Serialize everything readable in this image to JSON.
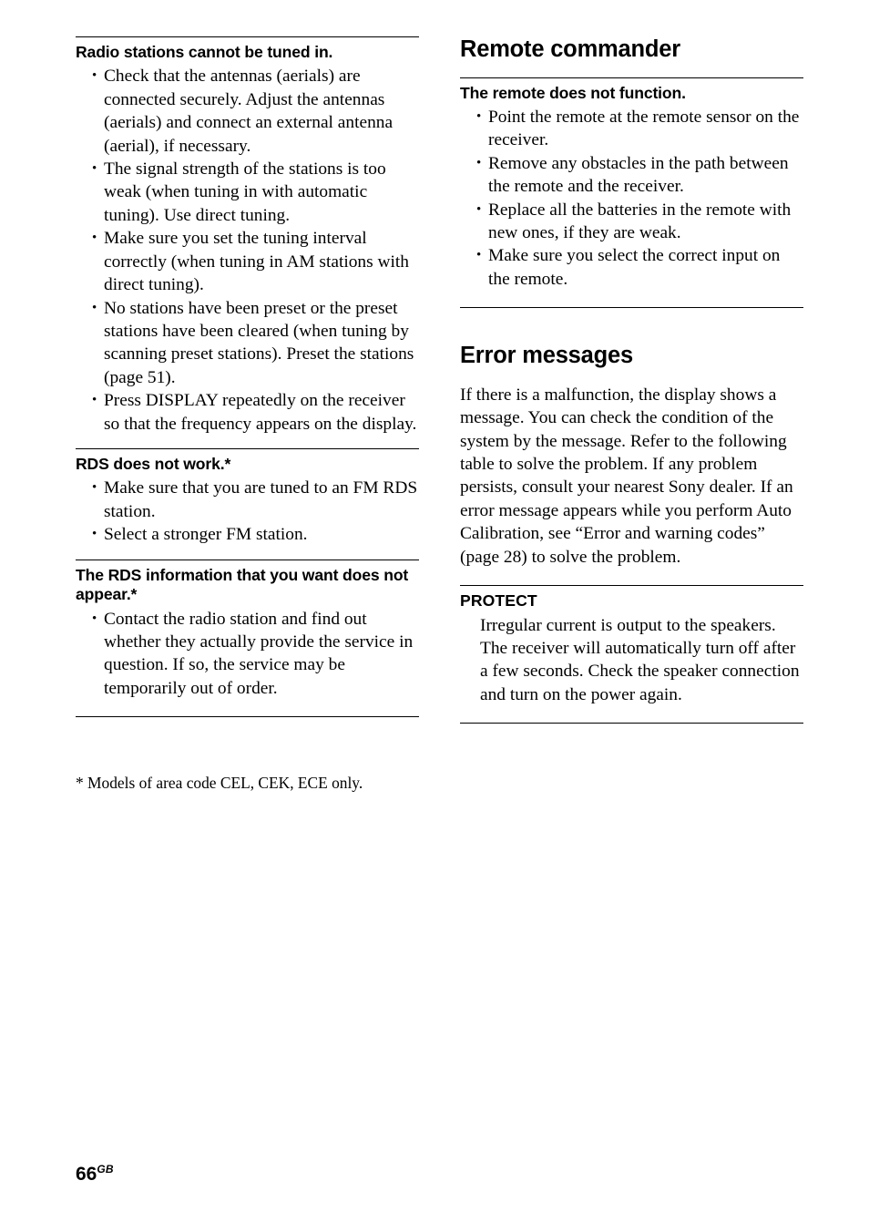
{
  "page": {
    "number": "66",
    "region_code": "GB",
    "footnote": "* Models of area code CEL, CEK, ECE only."
  },
  "left_column": {
    "blocks": [
      {
        "heading": "Radio stations cannot be tuned in.",
        "bullets": [
          "Check that the antennas (aerials) are connected securely. Adjust the antennas (aerials) and connect an external antenna (aerial), if necessary.",
          "The signal strength of the stations is too weak (when tuning in with automatic tuning). Use direct tuning.",
          "Make sure you set the tuning interval correctly (when tuning in AM stations with direct tuning).",
          "No stations have been preset or the preset stations have been cleared (when tuning by scanning preset stations). Preset the stations (page 51).",
          "Press DISPLAY repeatedly on the receiver so that the frequency appears on the display."
        ]
      },
      {
        "heading": "RDS does not work.*",
        "bullets": [
          "Make sure that you are tuned to an FM RDS station.",
          "Select a stronger FM station."
        ]
      },
      {
        "heading": "The RDS information that you want does not appear.*",
        "bullets": [
          "Contact the radio station and find out whether they actually provide the service in question. If so, the service may be temporarily out of order."
        ]
      }
    ]
  },
  "right_column": {
    "section_remote": {
      "title": "Remote commander",
      "subsection": {
        "heading": "The remote does not function.",
        "bullets": [
          "Point the remote at the remote sensor on the receiver.",
          "Remove any obstacles in the path between the remote and the receiver.",
          "Replace all the batteries in the remote with new ones, if they are weak.",
          "Make sure you select the correct input on the remote."
        ]
      }
    },
    "section_errors": {
      "title": "Error messages",
      "intro": "If there is a malfunction, the display shows a message. You can check the condition of the system by the message. Refer to the following table to solve the problem. If any problem persists, consult your nearest Sony dealer. If an error message appears while you perform Auto Calibration, see “Error and warning codes” (page 28) to solve the problem.",
      "entries": [
        {
          "code": "PROTECT",
          "description": "Irregular current is output to the speakers. The receiver will automatically turn off after a few seconds. Check the speaker connection and turn on the power again."
        }
      ]
    }
  }
}
